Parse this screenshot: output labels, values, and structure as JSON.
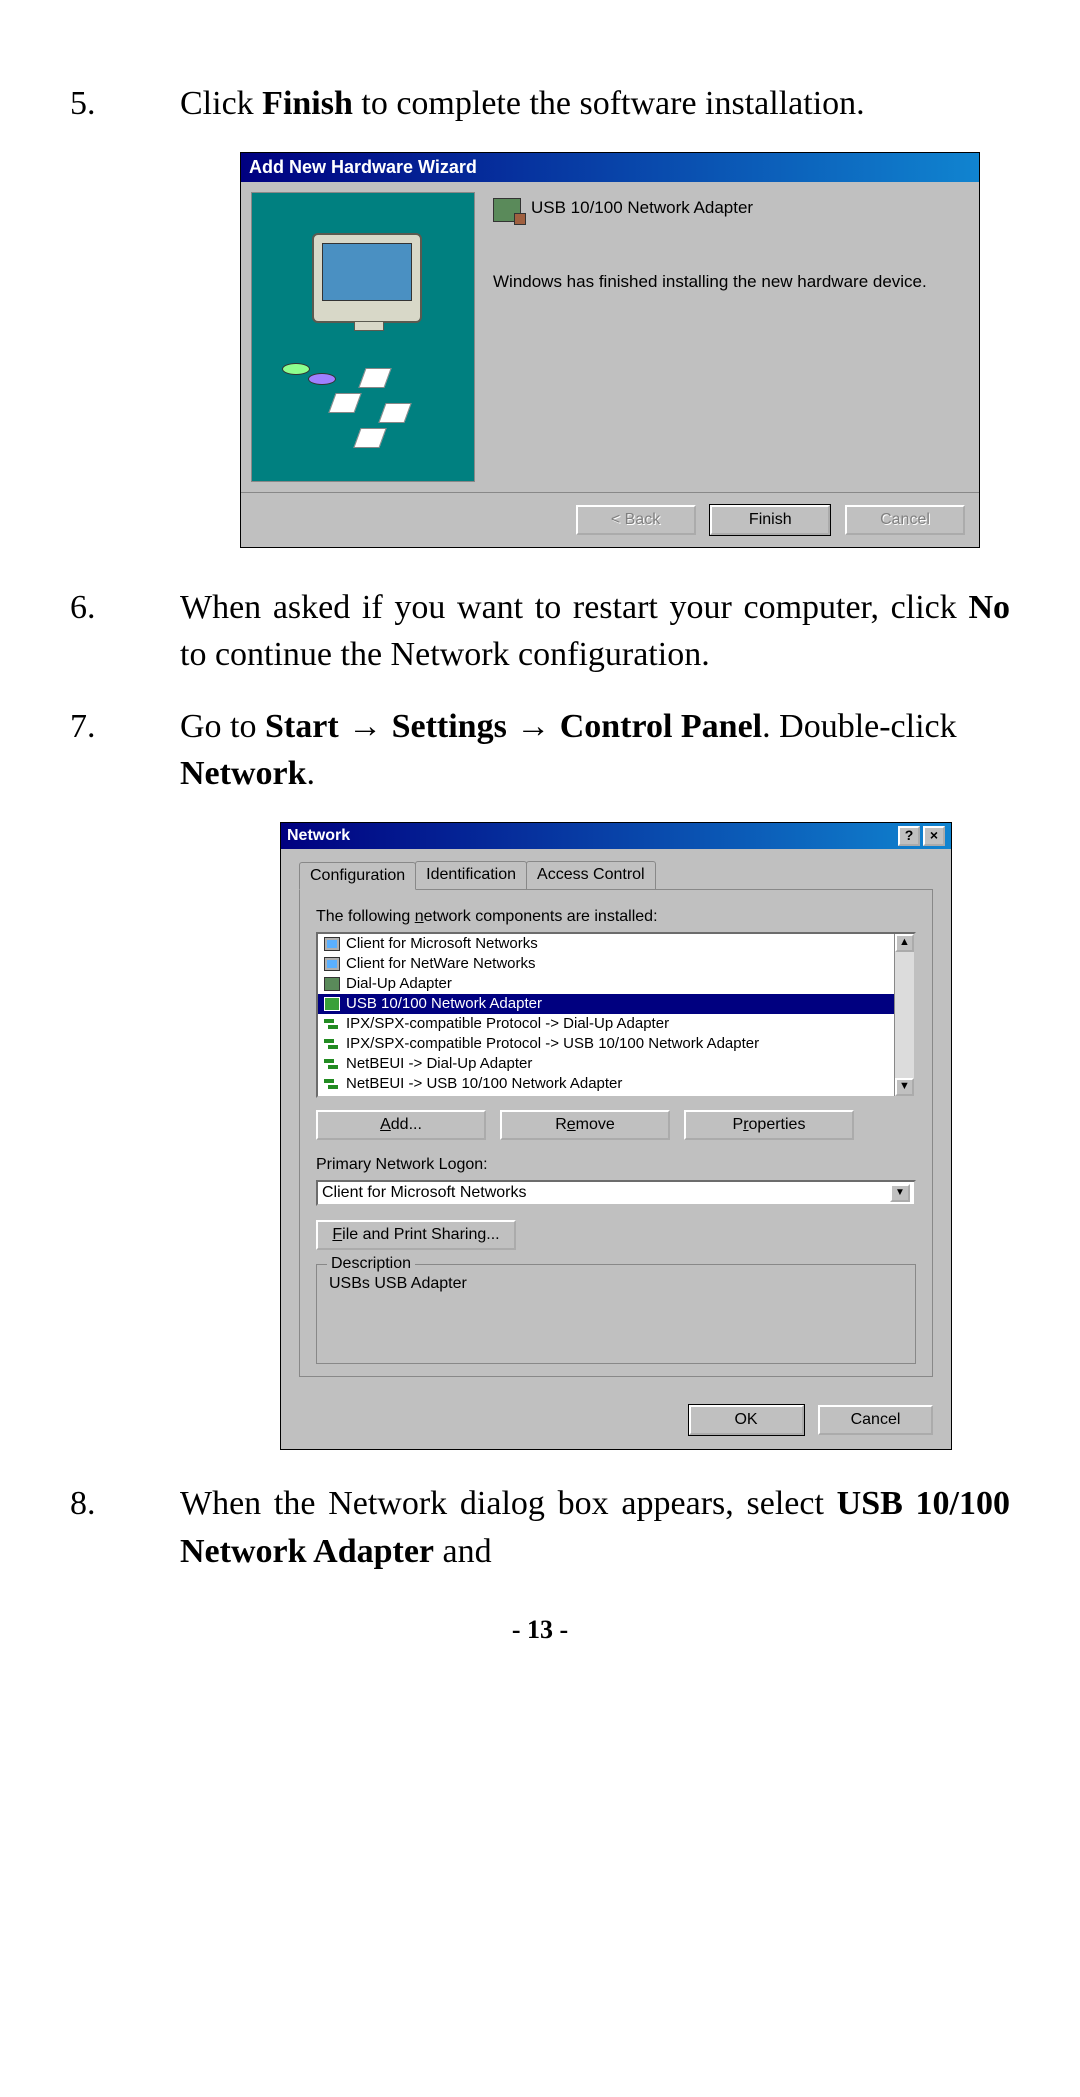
{
  "steps": {
    "s5": {
      "num": "5.",
      "pre": "Click ",
      "bold": "Finish",
      "post": " to complete the software installation."
    },
    "s6": {
      "num": "6.",
      "pre": "When asked if you want to restart your computer, click ",
      "bold": "No",
      "post": " to continue the Network configuration."
    },
    "s7": {
      "num": "7.",
      "pre": "Go to ",
      "b1": "Start",
      "arr": " → ",
      "b2": "Settings",
      "b3": "Control Panel",
      "post1": ". Double-click ",
      "b4": "Network",
      "post2": "."
    },
    "s8": {
      "num": "8.",
      "pre": "When the Network dialog box appears, select ",
      "bold": "USB 10/100 Network Adapter",
      "post": " and"
    }
  },
  "wizard": {
    "title": "Add New Hardware Wizard",
    "device": "USB 10/100 Network Adapter",
    "body": "Windows has finished installing the new hardware device.",
    "back": "< Back",
    "finish": "Finish",
    "cancel": "Cancel"
  },
  "network": {
    "title": "Network",
    "help": "?",
    "close": "×",
    "tabs": {
      "config": "Configuration",
      "ident": "Identification",
      "access": "Access Control"
    },
    "componentsLabel": "The following network components are installed:",
    "items": [
      "Client for Microsoft Networks",
      "Client for NetWare Networks",
      "Dial-Up Adapter",
      "USB 10/100 Network Adapter",
      "IPX/SPX-compatible Protocol -> Dial-Up Adapter",
      "IPX/SPX-compatible Protocol -> USB 10/100 Network Adapter",
      "NetBEUI -> Dial-Up Adapter",
      "NetBEUI -> USB 10/100 Network Adapter"
    ],
    "add": "Add...",
    "remove": "Remove",
    "properties": "Properties",
    "logonLabel": "Primary Network Logon:",
    "logonValue": "Client for Microsoft Networks",
    "fileShare": "File and Print Sharing...",
    "descLabel": "Description",
    "descText": "USBs USB Adapter",
    "ok": "OK",
    "cancel": "Cancel"
  },
  "pageNum": "- 13 -"
}
